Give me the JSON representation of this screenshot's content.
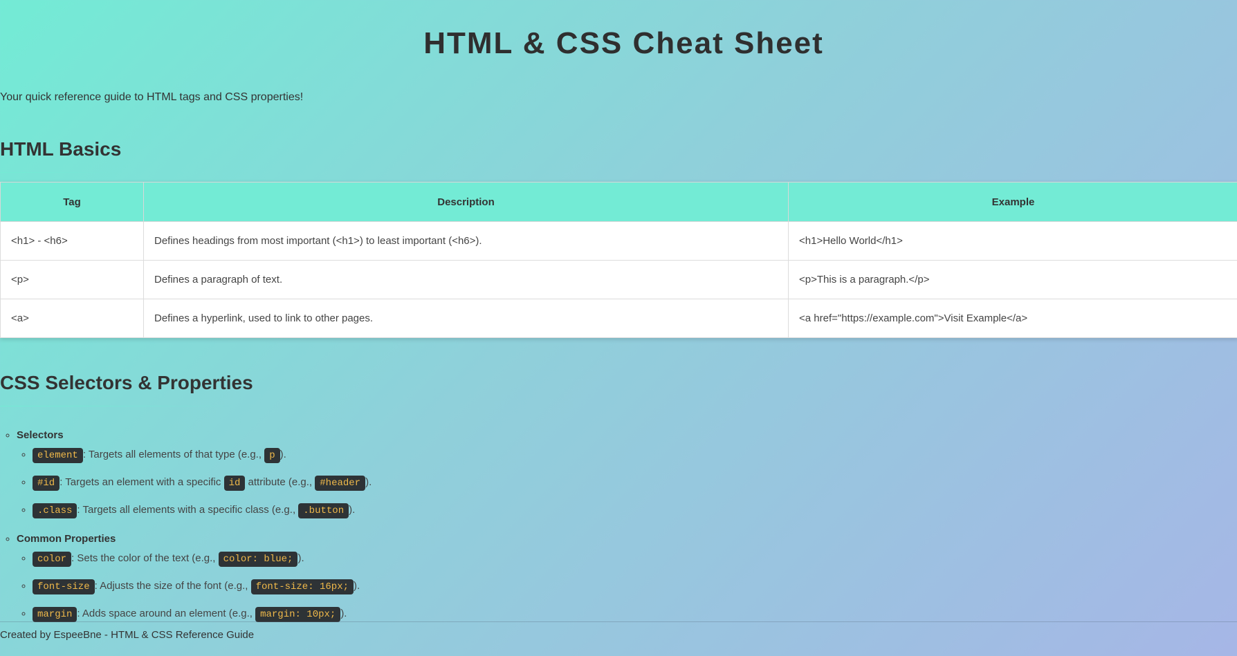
{
  "header": {
    "title": "HTML & CSS Cheat Sheet",
    "subtitle": "Your quick reference guide to HTML tags and CSS properties!"
  },
  "html_basics": {
    "heading": "HTML Basics",
    "columns": [
      "Tag",
      "Description",
      "Example"
    ],
    "rows": [
      {
        "tag": "<h1> - <h6>",
        "description": "Defines headings from most important (<h1>) to least important (<h6>).",
        "example": "<h1>Hello World</h1>"
      },
      {
        "tag": "<p>",
        "description": "Defines a paragraph of text.",
        "example": "<p>This is a paragraph.</p>"
      },
      {
        "tag": "<a>",
        "description": "Defines a hyperlink, used to link to other pages.",
        "example": "<a href=\"https://example.com\">Visit Example</a>"
      }
    ]
  },
  "css": {
    "heading": "CSS Selectors & Properties",
    "selectors": {
      "label": "Selectors",
      "items": [
        {
          "code": "element",
          "text1": ": Targets all elements of that type (e.g., ",
          "code2": "p",
          "text2": ")."
        },
        {
          "code": "#id",
          "text1": ": Targets an element with a specific ",
          "code_mid": "id",
          "text_mid": " attribute (e.g., ",
          "code2": "#header",
          "text2": ")."
        },
        {
          "code": ".class",
          "text1": ": Targets all elements with a specific class (e.g., ",
          "code2": ".button",
          "text2": ")."
        }
      ]
    },
    "properties": {
      "label": "Common Properties",
      "items": [
        {
          "code": "color",
          "text1": ": Sets the color of the text (e.g., ",
          "code2": "color: blue;",
          "text2": ")."
        },
        {
          "code": "font-size",
          "text1": ": Adjusts the size of the font (e.g., ",
          "code2": "font-size: 16px;",
          "text2": ")."
        },
        {
          "code": "margin",
          "text1": ": Adds space around an element (e.g., ",
          "code2": "margin: 10px;",
          "text2": ")."
        }
      ]
    }
  },
  "footer": {
    "text": "Created by EspeeBne - HTML & CSS Reference Guide"
  },
  "colors": {
    "accent": "#73ebd5",
    "code_bg": "#2e3336",
    "code_text": "#f0b94a"
  }
}
